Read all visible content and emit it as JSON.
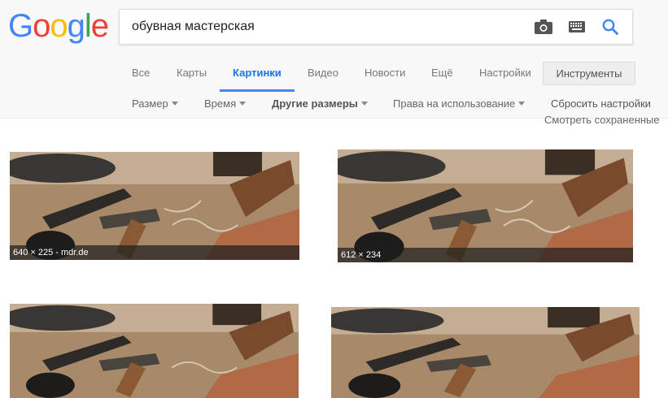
{
  "logo": {
    "letters": [
      "G",
      "o",
      "o",
      "g",
      "l",
      "e"
    ]
  },
  "search": {
    "query": "обувная мастерская"
  },
  "tabs": [
    {
      "label": "Все"
    },
    {
      "label": "Карты"
    },
    {
      "label": "Картинки"
    },
    {
      "label": "Видео"
    },
    {
      "label": "Новости"
    },
    {
      "label": "Ещё"
    },
    {
      "label": "Настройки"
    }
  ],
  "tools_label": "Инструменты",
  "filters": {
    "size": "Размер",
    "time": "Время",
    "other_sizes": "Другие размеры",
    "rights": "Права на использование",
    "reset": "Сбросить настройки",
    "saved": "Смотреть сохраненные"
  },
  "results": [
    {
      "caption": "640 × 225 - mdr.de"
    },
    {
      "caption": "612 × 234"
    },
    {
      "caption": ""
    },
    {
      "caption": ""
    }
  ],
  "colors": {
    "accent": "#4285f4",
    "header_bg": "#f8f8f8"
  }
}
